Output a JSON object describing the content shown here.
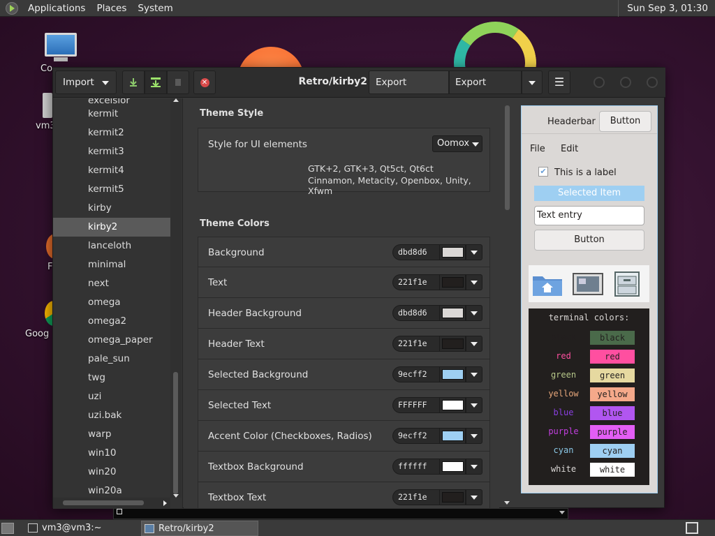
{
  "top_panel": {
    "menus": [
      "Applications",
      "Places",
      "System"
    ],
    "clock": "Sun Sep  3, 01:30"
  },
  "desktop": {
    "icons": [
      {
        "label": "Co",
        "icon": "computer-icon"
      },
      {
        "label": "vm3",
        "icon": "home-folder-icon"
      },
      {
        "label": "F",
        "icon": "firefox-icon"
      },
      {
        "label": "Goog",
        "icon": "chrome-icon"
      }
    ]
  },
  "window": {
    "title": "Retro/kirby2",
    "import_label": "Import",
    "export_theme_label": "Export Theme…",
    "export_icons_label": "Export Icons…",
    "toolbar_icons": [
      "download-icon",
      "apply-icon",
      "rename-icon",
      "remove-icon"
    ]
  },
  "sidebar": {
    "items": [
      "excelsior",
      "kermit",
      "kermit2",
      "kermit3",
      "kermit4",
      "kermit5",
      "kirby",
      "kirby2",
      "lanceloth",
      "minimal",
      "next",
      "omega",
      "omega2",
      "omega_paper",
      "pale_sun",
      "twg",
      "uzi",
      "uzi.bak",
      "warp",
      "win10",
      "win20",
      "win20a"
    ],
    "selected": "kirby2"
  },
  "settings": {
    "theme_style_title": "Theme Style",
    "style_label": "Style for UI elements",
    "style_value": "Oomox",
    "style_desc_1": "GTK+2, GTK+3, Qt5ct, Qt6ct",
    "style_desc_2": "Cinnamon, Metacity, Openbox, Unity, Xfwm",
    "theme_colors_title": "Theme Colors",
    "colors": [
      {
        "label": "Background",
        "hex": "dbd8d6",
        "color": "#dbd8d6"
      },
      {
        "label": "Text",
        "hex": "221f1e",
        "color": "#221f1e"
      },
      {
        "label": "Header Background",
        "hex": "dbd8d6",
        "color": "#dbd8d6"
      },
      {
        "label": "Header Text",
        "hex": "221f1e",
        "color": "#221f1e"
      },
      {
        "label": "Selected Background",
        "hex": "9ecff2",
        "color": "#9ecff2"
      },
      {
        "label": "Selected Text",
        "hex": "FFFFFF",
        "color": "#ffffff"
      },
      {
        "label": "Accent Color (Checkboxes, Radios)",
        "hex": "9ecff2",
        "color": "#9ecff2"
      },
      {
        "label": "Textbox Background",
        "hex": "ffffff",
        "color": "#ffffff"
      },
      {
        "label": "Textbox Text",
        "hex": "221f1e",
        "color": "#221f1e"
      }
    ]
  },
  "preview": {
    "headerbar_label": "Headerbar",
    "headerbar_button": "Button",
    "menu_file": "File",
    "menu_edit": "Edit",
    "checkbox_label": "This is a label",
    "selected_item": "Selected Item",
    "text_entry": "Text entry",
    "button": "Button",
    "terminal_title": "terminal colors:",
    "terminal_colors": [
      {
        "name": "black",
        "fg": "#221f1e",
        "bg": "#4a6a4a",
        "bg_text": "#221f1e"
      },
      {
        "name": "red",
        "fg": "#ff4fa0",
        "bg": "#ff4fa0",
        "bg_text": "#221f1e"
      },
      {
        "name": "green",
        "fg": "#b7c88a",
        "bg": "#e6d9a0",
        "bg_text": "#221f1e"
      },
      {
        "name": "yellow",
        "fg": "#e6a67a",
        "bg": "#f5a98a",
        "bg_text": "#221f1e"
      },
      {
        "name": "blue",
        "fg": "#8a3fe0",
        "bg": "#b156f0",
        "bg_text": "#221f1e"
      },
      {
        "name": "purple",
        "fg": "#c33fe0",
        "bg": "#e35ef5",
        "bg_text": "#221f1e"
      },
      {
        "name": "cyan",
        "fg": "#8ac7e6",
        "bg": "#9ecff2",
        "bg_text": "#221f1e"
      },
      {
        "name": "white",
        "fg": "#dbd8d6",
        "bg": "#ffffff",
        "bg_text": "#221f1e"
      }
    ]
  },
  "taskbar": {
    "tasks": [
      "vm3@vm3:~",
      "Retro/kirby2"
    ]
  }
}
